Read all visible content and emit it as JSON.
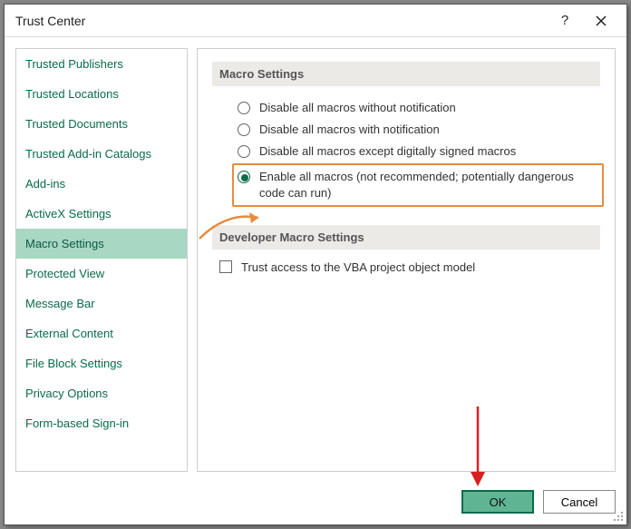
{
  "titlebar": {
    "title": "Trust Center"
  },
  "sidebar": {
    "items": [
      {
        "label": "Trusted Publishers",
        "selected": false
      },
      {
        "label": "Trusted Locations",
        "selected": false
      },
      {
        "label": "Trusted Documents",
        "selected": false
      },
      {
        "label": "Trusted Add-in Catalogs",
        "selected": false
      },
      {
        "label": "Add-ins",
        "selected": false
      },
      {
        "label": "ActiveX Settings",
        "selected": false
      },
      {
        "label": "Macro Settings",
        "selected": true
      },
      {
        "label": "Protected View",
        "selected": false
      },
      {
        "label": "Message Bar",
        "selected": false
      },
      {
        "label": "External Content",
        "selected": false
      },
      {
        "label": "File Block Settings",
        "selected": false
      },
      {
        "label": "Privacy Options",
        "selected": false
      },
      {
        "label": "Form-based Sign-in",
        "selected": false
      }
    ]
  },
  "main": {
    "section1_title": "Macro Settings",
    "radios": [
      {
        "label": "Disable all macros without notification",
        "checked": false
      },
      {
        "label": "Disable all macros with notification",
        "checked": false
      },
      {
        "label": "Disable all macros except digitally signed macros",
        "checked": false
      },
      {
        "label": "Enable all macros (not recommended; potentially dangerous code can run)",
        "checked": true
      }
    ],
    "section2_title": "Developer Macro Settings",
    "checkbox_label": "Trust access to the VBA project object model",
    "checkbox_checked": false
  },
  "footer": {
    "ok_label": "OK",
    "cancel_label": "Cancel"
  },
  "colors": {
    "accent": "#0a6b4a",
    "selected_bg": "#a8d7c4",
    "highlight_border": "#e88b3e",
    "arrow_red": "#d7201f"
  }
}
